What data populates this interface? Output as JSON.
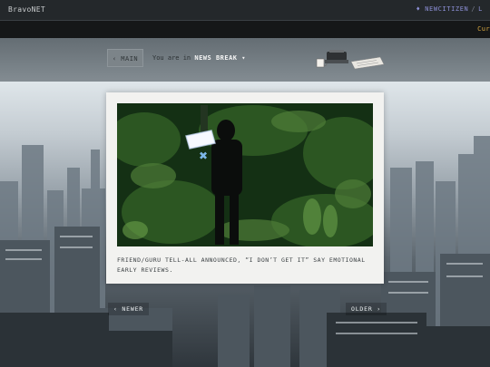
{
  "site": {
    "brand": "BravoNET",
    "top_links": [
      "♦ NEWCITIZEN",
      "/",
      "L"
    ],
    "ticker": "Cur"
  },
  "header": {
    "main_button": "‹ MAIN",
    "breadcrumb_prefix": "You are in",
    "breadcrumb_current": "NEWS BREAK ▾"
  },
  "article": {
    "headline": "FRIEND/GURU TELL-ALL ANNOUNCED, “I DON’T GET IT” SAY EMOTIONAL EARLY REVIEWS.",
    "image_alt": "Figure in dark foliage holding a glowing tablet"
  },
  "pagination": {
    "newer": "‹ NEWER",
    "older": "OLDER ›"
  },
  "colors": {
    "topbar": "#24282b",
    "link": "#8c8fd6",
    "ticker": "#d9a941",
    "card": "#f2f2f0"
  }
}
